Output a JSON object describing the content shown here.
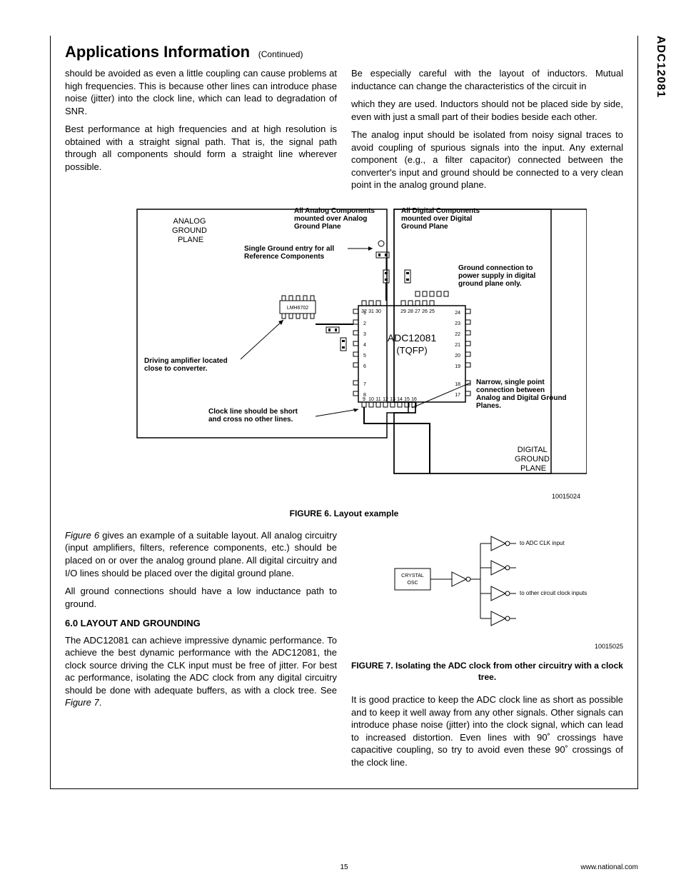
{
  "sideLabel": "ADC12081",
  "sectionTitle": "Applications Information",
  "continued": "(Continued)",
  "topParagraphs": [
    "should be avoided as even a little coupling can cause problems at high frequencies. This is because other lines can introduce phase noise (jitter) into the clock line, which can lead to degradation of SNR.",
    "Best performance at high frequencies and at high resolution is obtained with a straight signal path. That is, the signal path through all components should form a straight line wherever possible.",
    "Be especially careful with the layout of inductors. Mutual inductance can change the characteristics of the circuit in",
    "which they are used. Inductors should not be placed side by side, even with just a small part of their bodies beside each other.",
    "The analog input should be isolated from noisy signal traces to avoid coupling of spurious signals into the input. Any external component (e.g., a filter capacitor) connected between the converter's input and ground should be connected to a very clean point in the analog ground plane."
  ],
  "figure6": {
    "id": "10015024",
    "caption": "FIGURE 6. Layout example",
    "labels": {
      "analogGroundPlane": "ANALOG\nGROUND\nPLANE",
      "allAnalog": "All Analog Components\nmounted over Analog\nGround Plane",
      "allDigital": "All Digital Components\nmounted over Digital\nGround Plane",
      "singleGround": "Single Ground entry for all\nReference Components",
      "groundConnection": "Ground connection to\npower supply in digital\nground plane only.",
      "chip": "ADC12081\n(TQFP)",
      "amplifier": "LMH6702",
      "drivingAmp": "Driving amplifier located\nclose to converter.",
      "clockLine": "Clock line should be short\nand cross no other lines.",
      "narrowPoint": "Narrow, single point\nconnection between\nAnalog and Digital Ground\nPlanes.",
      "digitalGroundPlane": "DIGITAL\nGROUND\nPLANE"
    }
  },
  "midParagraphs": {
    "fig6ref": "Figure 6",
    "fig6text": " gives an example of a suitable layout. All analog circuitry (input amplifiers, filters, reference components, etc.) should be placed on or over the analog ground plane. All digital circuitry and I/O lines should be placed over the digital ground plane.",
    "groundConn": "All ground connections should have a low inductance path to ground."
  },
  "subsection": {
    "title": "6.0 LAYOUT AND GROUNDING",
    "text1": "The ADC12081 can achieve impressive dynamic performance. To achieve the best dynamic performance with the ADC12081, the clock source driving the CLK input must be free of jitter. For best ac performance, isolating the ADC clock from any digital circuitry should be done with adequate buffers, as with a clock tree. See ",
    "fig7ref": "Figure 7",
    "text1end": "."
  },
  "figure7": {
    "id": "10015025",
    "caption": "FIGURE 7. Isolating the ADC clock from other circuitry with a clock tree.",
    "labels": {
      "crystal": "CRYSTAL\nOSC",
      "adcInput": "to ADC CLK input",
      "otherInputs": "to other circuit clock inputs"
    }
  },
  "bottomParagraph": "It is good practice to keep the ADC clock line as short as possible and to keep it well away from any other signals. Other signals can introduce phase noise (jitter) into the clock signal, which can lead to increased distortion. Even lines with 90˚ crossings have capacitive coupling, so try to avoid even these 90˚ crossings of the clock line.",
  "footer": {
    "pageNum": "15",
    "url": "www.national.com"
  }
}
